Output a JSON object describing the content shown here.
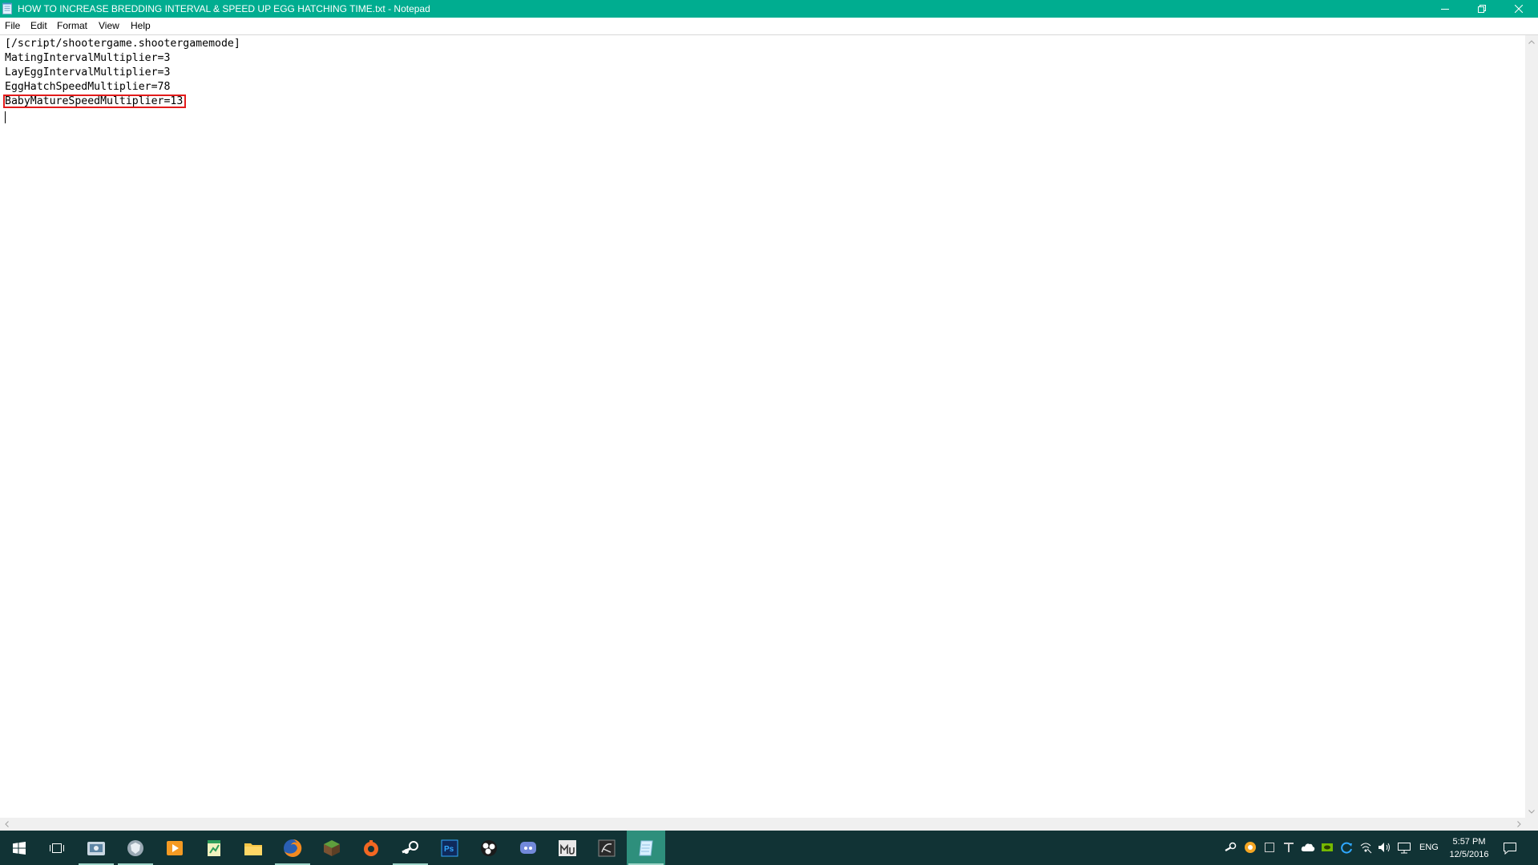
{
  "window": {
    "title": "HOW TO INCREASE BREDDING INTERVAL & SPEED UP EGG HATCHING TIME.txt - Notepad"
  },
  "menu": {
    "items": [
      "File",
      "Edit",
      "Format",
      "View",
      "Help"
    ]
  },
  "editor": {
    "lines": [
      "[/script/shootergame.shootergamemode]",
      "MatingIntervalMultiplier=3",
      "LayEggIntervalMultiplier=3",
      "EggHatchSpeedMultiplier=78",
      "BabyMatureSpeedMultiplier=13"
    ],
    "highlighted_line_index": 4,
    "highlight_color": "#e21b1b"
  },
  "taskbar": {
    "apps": [
      "windows-start-icon",
      "task-view-icon",
      "file-manager-icon",
      "shield-browser-icon",
      "media-player-icon",
      "spreadsheet-icon",
      "file-explorer-icon",
      "firefox-icon",
      "minecraft-icon",
      "origin-icon",
      "steam-icon",
      "photoshop-icon",
      "obs-icon",
      "discord-icon",
      "mu-app-icon",
      "graphics-app-icon",
      "notepad-icon"
    ],
    "photoshop_label": "Ps",
    "tray": {
      "language": "ENG",
      "time": "5:57 PM",
      "date": "12/5/2016"
    },
    "colors": {
      "taskbar_bg": "#113335",
      "accent": "#00ad90"
    }
  }
}
